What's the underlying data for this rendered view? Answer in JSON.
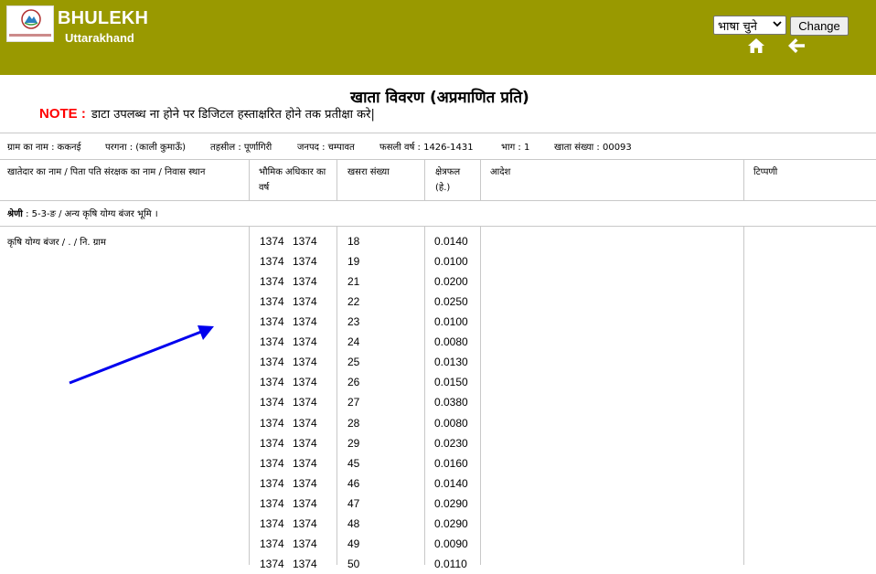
{
  "header": {
    "app_title": "BHULEKH",
    "app_subtitle": "Uttarakhand",
    "language_select_value": "भाषा चुने",
    "change_button": "Change",
    "icons": [
      "home-icon",
      "back-arrow-icon",
      "chevron-down-icon"
    ],
    "background_color": "#999900"
  },
  "document": {
    "title": "खाता विवरण (अप्रमाणित प्रति)",
    "note_label": "NOTE :",
    "note_text": "डाटा उपलब्ध ना होने पर डिजिटल हस्ताक्षरित होने तक प्रतीक्षा करे|"
  },
  "info": {
    "village": "ग्राम का नाम : ककनई",
    "pargana": "परगना : (काली कुमाऊँ)",
    "tehsil": "तहसील : पूर्णागिरी",
    "district": "जनपद : चम्पावत",
    "fasli_year": "फसली वर्ष : 1426-1431",
    "part": "भाग : 1",
    "khata_number": "खाता संख्या : 00093"
  },
  "table": {
    "headers": {
      "owner": "खातेदार का नाम / पिता पति संरक्षक का नाम / निवास स्थान",
      "land_right_line1": "भौमिक अधिकार का",
      "land_right_line2": "वर्ष",
      "khasra": "खसरा संख्या",
      "area_line1": "क्षेत्रफल",
      "area_line2": "(हे.)",
      "order": "आदेश",
      "remark": "टिप्पणी"
    },
    "category_label": "श्रेणी",
    "category_text": " : 5-3-ङ / अन्य कृषि योग्य बंजर भूमि ।",
    "owner_text": "कृषि योग्य बंजर / . / नि. ग्राम",
    "rows": [
      {
        "yr1": "1374",
        "yr2": "1374",
        "khasra": "18",
        "area": "0.0140"
      },
      {
        "yr1": "1374",
        "yr2": "1374",
        "khasra": "19",
        "area": "0.0100"
      },
      {
        "yr1": "1374",
        "yr2": "1374",
        "khasra": "21",
        "area": "0.0200"
      },
      {
        "yr1": "1374",
        "yr2": "1374",
        "khasra": "22",
        "area": "0.0250"
      },
      {
        "yr1": "1374",
        "yr2": "1374",
        "khasra": "23",
        "area": "0.0100"
      },
      {
        "yr1": "1374",
        "yr2": "1374",
        "khasra": "24",
        "area": "0.0080"
      },
      {
        "yr1": "1374",
        "yr2": "1374",
        "khasra": "25",
        "area": "0.0130"
      },
      {
        "yr1": "1374",
        "yr2": "1374",
        "khasra": "26",
        "area": "0.0150"
      },
      {
        "yr1": "1374",
        "yr2": "1374",
        "khasra": "27",
        "area": "0.0380"
      },
      {
        "yr1": "1374",
        "yr2": "1374",
        "khasra": "28",
        "area": "0.0080"
      },
      {
        "yr1": "1374",
        "yr2": "1374",
        "khasra": "29",
        "area": "0.0230"
      },
      {
        "yr1": "1374",
        "yr2": "1374",
        "khasra": "45",
        "area": "0.0160"
      },
      {
        "yr1": "1374",
        "yr2": "1374",
        "khasra": "46",
        "area": "0.0140"
      },
      {
        "yr1": "1374",
        "yr2": "1374",
        "khasra": "47",
        "area": "0.0290"
      },
      {
        "yr1": "1374",
        "yr2": "1374",
        "khasra": "48",
        "area": "0.0290"
      },
      {
        "yr1": "1374",
        "yr2": "1374",
        "khasra": "49",
        "area": "0.0090"
      },
      {
        "yr1": "1374",
        "yr2": "1374",
        "khasra": "50",
        "area": "0.0110"
      }
    ]
  },
  "annotation": {
    "arrow_color": "#0000ee"
  }
}
